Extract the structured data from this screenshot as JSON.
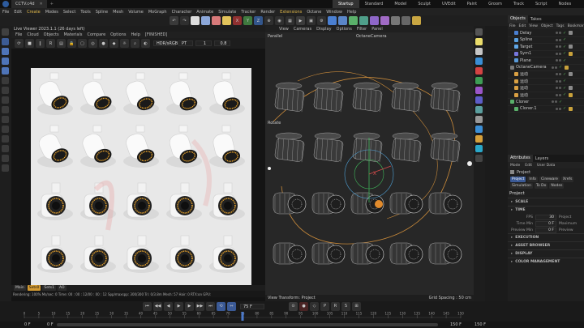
{
  "titlebar": {
    "tab": "CCTV.c4d",
    "layouts": [
      "Startup",
      "Standard",
      "Model",
      "Sculpt",
      "UVEdit",
      "Paint",
      "Groom",
      "Track",
      "Script",
      "Nodes"
    ]
  },
  "menubar": [
    "File",
    "Edit",
    "Create",
    "Modes",
    "Select",
    "Tools",
    "Spline",
    "Mesh",
    "Volume",
    "MoGraph",
    "Character",
    "Animate",
    "Simulate",
    "Tracker",
    "Render",
    "Extensions",
    "Octane",
    "Window",
    "Help"
  ],
  "left_viewer": {
    "title": "Live Viewer 2023.1.1 (26 days left)",
    "menu": [
      "File",
      "Cloud",
      "Objects",
      "Materials",
      "Compare",
      "Options",
      "Help",
      "[FINISHED]"
    ],
    "toolbar": {
      "colorspace": "HDR/sRGB",
      "mode": "PT",
      "val1": "1",
      "val2": "0.8"
    },
    "channels": [
      "Main",
      "Sets0",
      "Sets1",
      "AO"
    ],
    "status": "Rendering: 100%  Ms/sec: 0  Time: 00 : 00 : 12/00 : 00 : 12  Spp/maxspp: 300/300  Tri: 0/3.8m  Mesh: 57  Hair: 0  RTX:on  GPU:"
  },
  "right_viewport": {
    "menu": [
      "View",
      "Cameras",
      "Display",
      "Options",
      "Filter",
      "Panel"
    ],
    "label_parallel": "Parallel",
    "label_camera": "OctaneCamera",
    "label_rotate": "Rotate",
    "axis": "X",
    "footer_left": "View Transform: Project",
    "footer_right": "Grid Spacing : 50 cm"
  },
  "objects_panel": {
    "tabs": [
      "Objects",
      "Takes"
    ],
    "menu": [
      "File",
      "Edit",
      "View",
      "Object",
      "Tags",
      "Bookmarks"
    ],
    "items": [
      {
        "name": "Delay",
        "indent": 1,
        "icon": "#4a7fd1"
      },
      {
        "name": "Spline",
        "indent": 1,
        "icon": "#5aa0e0"
      },
      {
        "name": "Target",
        "indent": 1,
        "icon": "#60a8e8"
      },
      {
        "name": "Sym1",
        "indent": 1,
        "icon": "#7777dd"
      },
      {
        "name": "Plane",
        "indent": 1,
        "icon": "#5a9ad8"
      },
      {
        "name": "OctaneCamera",
        "indent": 0,
        "icon": "#7a7a7a"
      },
      {
        "name": "运动",
        "indent": 1,
        "icon": "#d9a043"
      },
      {
        "name": "运动",
        "indent": 1,
        "icon": "#d9a043"
      },
      {
        "name": "运动",
        "indent": 1,
        "icon": "#d9a043"
      },
      {
        "name": "运动",
        "indent": 1,
        "icon": "#d9a043"
      },
      {
        "name": "Cloner",
        "indent": 0,
        "icon": "#5ab06a"
      },
      {
        "name": "Cloner.1",
        "indent": 1,
        "icon": "#5ab06a"
      }
    ]
  },
  "attributes_panel": {
    "tabs": [
      "Attributes",
      "Layers"
    ],
    "menu": [
      "Mode",
      "Edit",
      "User Data"
    ],
    "object_label": "Project",
    "subtabs": [
      "Project",
      "Info",
      "Cineware",
      "Xrefs",
      "Simulation",
      "To Do",
      "Nodes"
    ],
    "heading": "Project",
    "sections": [
      "SCALE",
      "TIME",
      "EXECUTION",
      "ASSET BROWSER",
      "DISPLAY",
      "COLOR MANAGEMENT"
    ],
    "fields": [
      {
        "label": "FPS",
        "value": "30",
        "right": "Project"
      },
      {
        "label": "Time Min",
        "value": "0 F",
        "right": "Maximum"
      },
      {
        "label": "Preview Min",
        "value": "0 F",
        "right": "Preview"
      }
    ]
  },
  "timeline": {
    "ticks": [
      "0",
      "5",
      "10",
      "15",
      "20",
      "25",
      "30",
      "35",
      "40",
      "45",
      "50",
      "55",
      "60",
      "65",
      "70",
      "75",
      "80",
      "85",
      "90",
      "95",
      "100",
      "105",
      "110",
      "115",
      "120",
      "125",
      "130",
      "135",
      "140",
      "145",
      "150"
    ],
    "current_frame": "75 F",
    "bottom": {
      "start": "0 F",
      "start2": "0 F",
      "end": "150 F",
      "end2": "150 F"
    }
  }
}
